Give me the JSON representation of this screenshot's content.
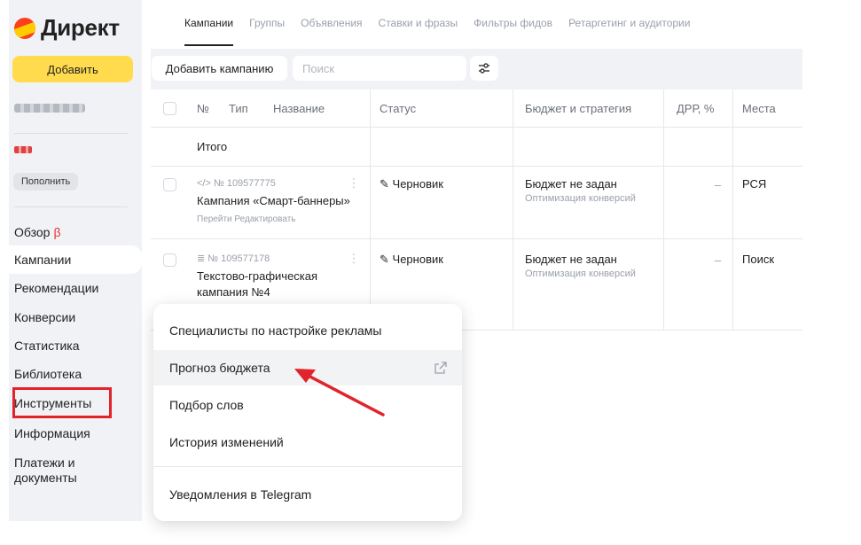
{
  "brand": {
    "name": "Директ"
  },
  "sidebar": {
    "add_label": "Добавить",
    "topup_label": "Пополнить",
    "items": [
      {
        "label": "Обзор",
        "badge": "β"
      },
      {
        "label": "Кампании"
      },
      {
        "label": "Рекомендации"
      },
      {
        "label": "Конверсии"
      },
      {
        "label": "Статистика"
      },
      {
        "label": "Библиотека"
      },
      {
        "label": "Инструменты"
      },
      {
        "label": "Информация"
      },
      {
        "label": "Платежи и документы"
      }
    ]
  },
  "tabs": [
    "Кампании",
    "Группы",
    "Объявления",
    "Ставки и фразы",
    "Фильтры фидов",
    "Ретаргетинг и аудитории"
  ],
  "toolbar": {
    "add_campaign_label": "Добавить кампанию",
    "search_placeholder": "Поиск"
  },
  "table": {
    "headers": {
      "no": "№",
      "type": "Тип",
      "name": "Название",
      "status": "Статус",
      "budget": "Бюджет и стратегия",
      "drr": "ДРР, %",
      "places": "Места"
    },
    "total_label": "Итого",
    "rows": [
      {
        "number": "№ 109577775",
        "name": "Кампания «Смарт-баннеры»",
        "actions": [
          "Перейти",
          "Редактировать"
        ],
        "status": "Черновик",
        "budget": "Бюджет не задан",
        "strategy": "Оптимизация конверсий",
        "drr": "–",
        "places": "РСЯ"
      },
      {
        "number": "№ 109577178",
        "name_line1": "Текстово-графическая",
        "name_line2": "кампания №4",
        "status": "Черновик",
        "budget": "Бюджет не задан",
        "strategy": "Оптимизация конверсий",
        "drr": "–",
        "places": "Поиск"
      }
    ]
  },
  "dropdown": {
    "items": [
      "Специалисты по настройке рекламы",
      "Прогноз бюджета",
      "Подбор слов",
      "История изменений",
      "Уведомления в Telegram"
    ]
  },
  "colors": {
    "accent_yellow": "#ffdb4d",
    "highlight_red": "#e1232b",
    "sidebar_bg": "#f1f2f5",
    "beta_red": "#e83333"
  },
  "icons": [
    "logo-icon",
    "filter-settings-icon",
    "code-icon",
    "text-graphic-icon",
    "pencil-icon",
    "kebab-menu-icon",
    "external-link-icon"
  ]
}
